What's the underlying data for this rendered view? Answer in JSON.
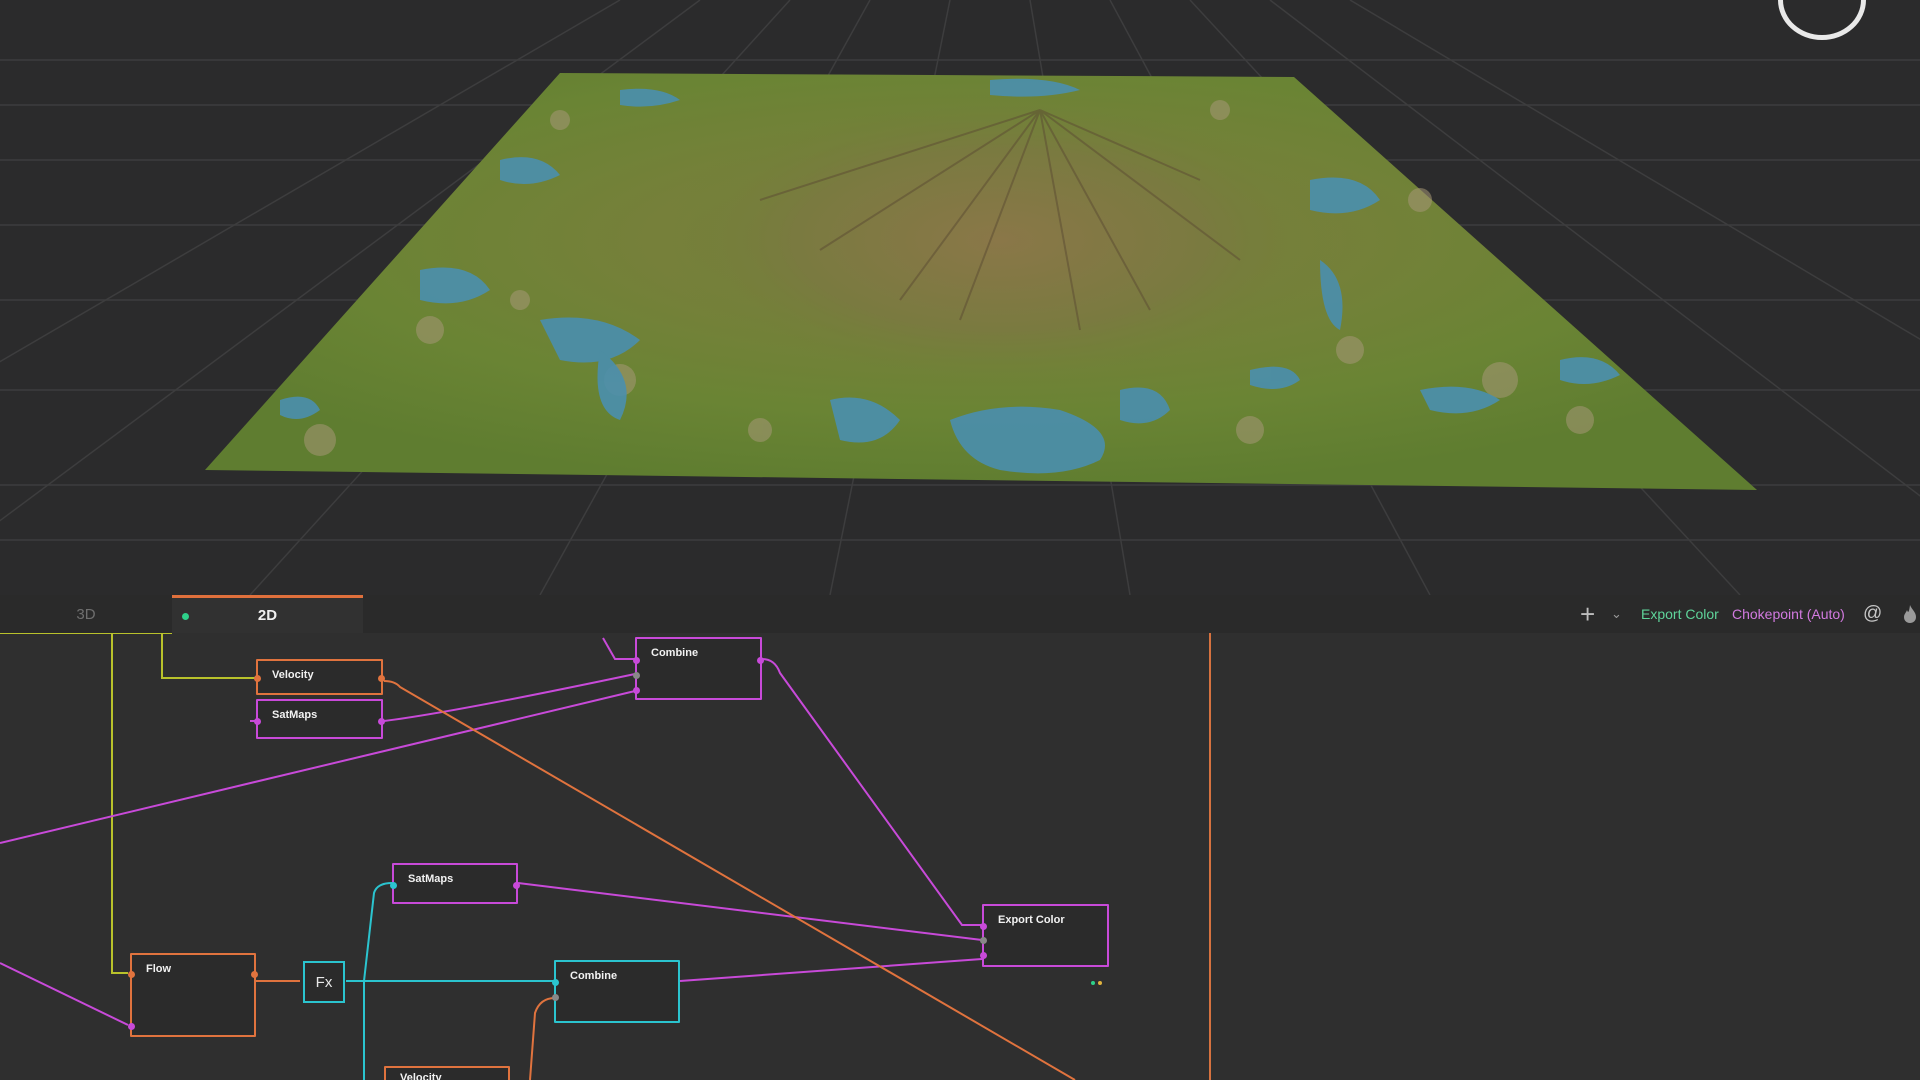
{
  "app": {
    "title": ""
  },
  "tabs": [
    {
      "label": "3D",
      "active": false
    },
    {
      "label": "2D",
      "active": true
    }
  ],
  "toolbar": {
    "add_icon": "plus-icon",
    "chevron_icon": "chevron-down-icon",
    "export_color_label": "Export Color",
    "chokepoint_label": "Chokepoint (Auto)",
    "at_icon": "at-icon",
    "fire_icon": "flame-icon"
  },
  "colors": {
    "accent_orange": "#e0733e",
    "node_magenta": "#c84ad9",
    "node_teal": "#2bc4cf",
    "wire_yellow": "#b9c22b",
    "export_green": "#5fd49a",
    "chokepoint_purple": "#d27ae0"
  },
  "graph": {
    "nodes": {
      "velocity_top": {
        "title": "Velocity"
      },
      "satmaps_top": {
        "title": "SatMaps"
      },
      "combine_top": {
        "title": "Combine"
      },
      "satmaps_mid": {
        "title": "SatMaps"
      },
      "export_color": {
        "title": "Export Color"
      },
      "flow": {
        "title": "Flow"
      },
      "fx": {
        "title": "Fx"
      },
      "combine_bottom": {
        "title": "Combine"
      },
      "velocity_bottom": {
        "title": "Velocity"
      }
    }
  }
}
